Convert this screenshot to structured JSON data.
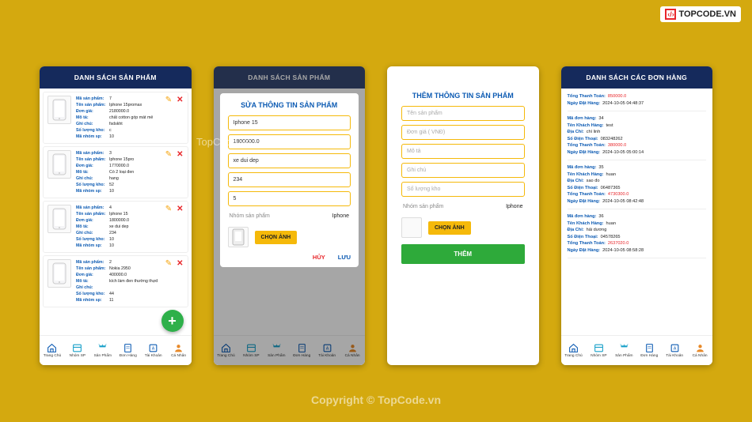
{
  "logo": {
    "glyph": "‹/›",
    "text": "TOPCODE.VN"
  },
  "watermark_inline": "TopCode.vn",
  "watermark_footer": "Copyright © TopCode.vn",
  "nav": {
    "items": [
      {
        "label": "Trang Chủ"
      },
      {
        "label": "Nhóm SP"
      },
      {
        "label": "Sản Phẩm"
      },
      {
        "label": "Đơn Hàng"
      },
      {
        "label": "Tài Khoản"
      },
      {
        "label": "Cá Nhân"
      }
    ]
  },
  "panel1": {
    "title": "DANH SÁCH  SẢN PHẨM",
    "fields": {
      "id": "Mã sản phẩm:",
      "name": "Tên sản phẩm:",
      "price": "Đơn giá:",
      "desc": "Mô tả:",
      "note": "Ghi chú:",
      "stock": "Số lượng kho:",
      "group": "Mã nhóm sp:"
    },
    "products": [
      {
        "id": "7",
        "name": "Iphone 15promax",
        "price": "2180000.0",
        "desc": "chất cotton góp mát mẻ",
        "note": "fsdskht",
        "stock": "c",
        "group": "10"
      },
      {
        "id": "3",
        "name": "Iphone 15pro",
        "price": "1770000.0",
        "desc": "Có 2 loại đen",
        "note": "hang",
        "stock": "52",
        "group": "10"
      },
      {
        "id": "4",
        "name": "Iphone 15",
        "price": "1800000.0",
        "desc": "xe dui dep",
        "note": "234",
        "stock": "10",
        "group": "10"
      },
      {
        "id": "2",
        "name": "Nokia 2950",
        "price": "400000.0",
        "desc": "kích làm đen thường thựd",
        "note": "",
        "stock": "44",
        "group": "11"
      }
    ]
  },
  "panel2": {
    "title": "DANH SÁCH  SẢN PHẨM",
    "dlg_title": "SỬA THÔNG TIN SẢN PHẨM",
    "fields": {
      "name": "Iphone 15",
      "price": "1800000.0",
      "desc": "xe dui dep",
      "note": "234",
      "stock": "5"
    },
    "group_label": "Nhóm sản phẩm",
    "group_value": "Iphone",
    "choose_img": "CHỌN ẢNH",
    "cancel": "HỦY",
    "save": "LƯU"
  },
  "panel3": {
    "dlg_title": "THÊM THÔNG TIN SẢN PHẨM",
    "ph": {
      "name": "Tên sản phẩm",
      "price": "Đơn giá ( VNĐ)",
      "desc": "Mô tả",
      "note": "Ghi chú",
      "stock": "Số lượng kho"
    },
    "group_label": "Nhóm sản phẩm",
    "group_value": "Iphone",
    "choose_img": "CHỌN ẢNH",
    "add": "THÊM"
  },
  "panel4": {
    "title": "DANH SÁCH CÁC ĐƠN HÀNG",
    "labels": {
      "total": "Tổng Thanh Toán:",
      "order_date": "Ngày Đặt Hàng:",
      "order_id": "Mã đơn hàng:",
      "customer": "Tên Khách Hàng:",
      "address": "Địa Chỉ:",
      "phone": "Số Điện Thoại:"
    },
    "orders": [
      {
        "partial": true,
        "total": "850000.0",
        "date": "2024-10-05 04:48:37"
      },
      {
        "id": "34",
        "customer": "test",
        "address": "chí linh",
        "phone": "083248262",
        "total": "380000.0",
        "date": "2024-10-05 05:00:14"
      },
      {
        "id": "35",
        "customer": "huan",
        "address": "sao đo",
        "phone": "06487365",
        "total": "4730300.0",
        "date": "2024-10-05 08:42:48"
      },
      {
        "id": "36",
        "customer": "huan",
        "address": "hải dương",
        "phone": "04578265",
        "total": "2637020.0",
        "date": "2024-10-05 08:58:28"
      }
    ]
  }
}
